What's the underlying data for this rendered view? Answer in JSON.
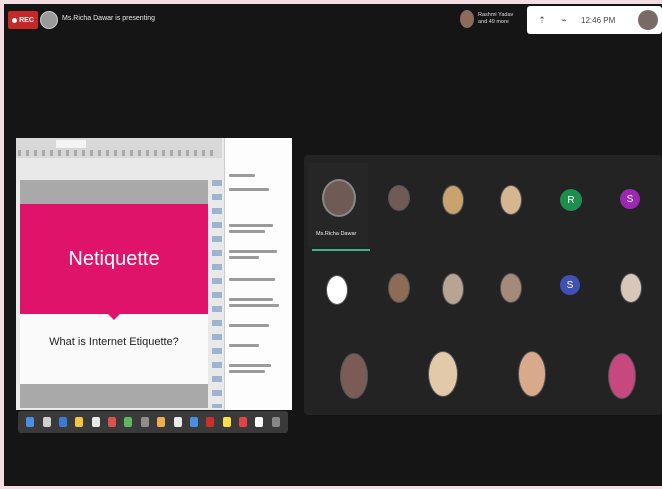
{
  "topbar": {
    "rec_label": "REC",
    "presenting_text": "Ms.Richa Dawar is presenting",
    "participant_name": "Rashmi Yadav",
    "participant_sub": "and 49 more",
    "time": "12:46 PM"
  },
  "slide": {
    "title": "Netiquette",
    "subtitle": "What is Internet Etiquette?"
  },
  "grid": {
    "active_name": "Ms.Richa Dawar",
    "tiles": [
      {
        "type": "photo",
        "color": "#6f5a55"
      },
      {
        "type": "photo",
        "color": "#c9a36e"
      },
      {
        "type": "photo",
        "color": "#d6b690"
      },
      {
        "type": "letter",
        "letter": "R",
        "color": "#1e8e4e"
      },
      {
        "type": "letter",
        "letter": "S",
        "color": "#9c27b0"
      },
      {
        "type": "photo",
        "color": "#ffffff"
      },
      {
        "type": "photo",
        "color": "#8e6b54"
      },
      {
        "type": "photo",
        "color": "#b8a492"
      },
      {
        "type": "photo",
        "color": "#a58a7b"
      },
      {
        "type": "letter",
        "letter": "S",
        "color": "#3f51b5"
      },
      {
        "type": "photo",
        "color": "#d8c7b9"
      },
      {
        "type": "photo",
        "color": "#7a5b55"
      },
      {
        "type": "photo",
        "color": "#e2c9a9"
      },
      {
        "type": "photo",
        "color": "#d9a98b"
      },
      {
        "type": "photo",
        "color": "#c6487f"
      }
    ]
  },
  "colors": {
    "slide_pink": "#e0136b",
    "active_underline": "#3cb48a",
    "rec_red": "#c62828"
  }
}
